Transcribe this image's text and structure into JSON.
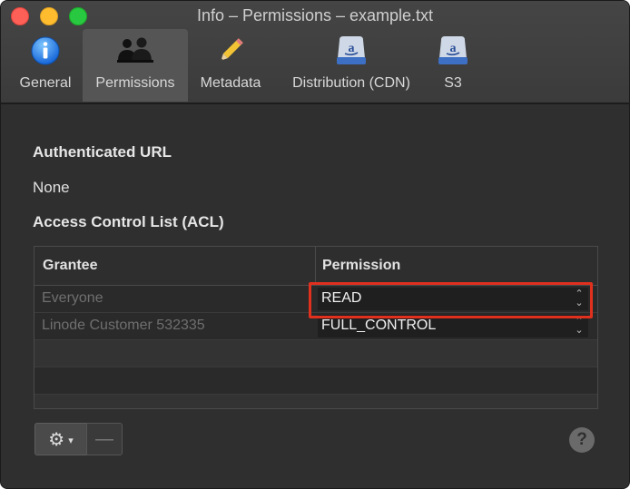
{
  "window": {
    "title": "Info – Permissions – example.txt"
  },
  "toolbar": {
    "tabs": [
      {
        "label": "General",
        "icon": "info-icon"
      },
      {
        "label": "Permissions",
        "icon": "people-icon",
        "selected": true
      },
      {
        "label": "Metadata",
        "icon": "pencil-icon"
      },
      {
        "label": "Distribution (CDN)",
        "icon": "amazon-disk-icon"
      },
      {
        "label": "S3",
        "icon": "amazon-disk-icon"
      }
    ]
  },
  "authenticated_url": {
    "heading": "Authenticated URL",
    "value": "None"
  },
  "acl": {
    "heading": "Access Control List (ACL)",
    "columns": [
      "Grantee",
      "Permission"
    ],
    "rows": [
      {
        "grantee": "Everyone",
        "permission": "READ"
      },
      {
        "grantee": "Linode Customer 532335",
        "permission": "FULL_CONTROL"
      }
    ]
  },
  "footer": {
    "gear_icon": "gear-icon",
    "minus_label": "—",
    "help_label": "?"
  },
  "colors": {
    "highlight": "#e0301e",
    "close": "#fe5f57",
    "minimize": "#febc2e",
    "maximize": "#28c840"
  }
}
